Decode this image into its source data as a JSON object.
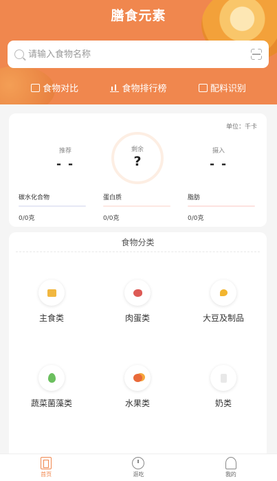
{
  "app": {
    "title": "膳食元素"
  },
  "search": {
    "placeholder": "请输入食物名称"
  },
  "quick_actions": [
    {
      "label": "食物对比",
      "icon": "compare-icon"
    },
    {
      "label": "食物排行榜",
      "icon": "ranking-icon"
    },
    {
      "label": "配料识别",
      "icon": "ingredient-scan-icon"
    }
  ],
  "summary": {
    "unit": "单位：千卡",
    "recommended": {
      "label": "推荐",
      "value": "- -"
    },
    "remaining": {
      "label": "剩余",
      "value": "?"
    },
    "intake": {
      "label": "摄入",
      "value": "- -"
    },
    "macros": [
      {
        "name": "碳水化合物",
        "amount": "0/0克",
        "color": "#e6e8f5"
      },
      {
        "name": "蛋白质",
        "amount": "0/0克",
        "color": "#fde7e2"
      },
      {
        "name": "脂肪",
        "amount": "0/0克",
        "color": "#fde2df"
      }
    ]
  },
  "categories": {
    "title": "食物分类",
    "items": [
      {
        "name": "主食类",
        "icon": "staple-food-icon"
      },
      {
        "name": "肉蛋类",
        "icon": "meat-egg-icon"
      },
      {
        "name": "大豆及制品",
        "icon": "soybean-icon"
      },
      {
        "name": "蔬菜菌藻类",
        "icon": "vegetable-icon"
      },
      {
        "name": "水果类",
        "icon": "fruit-icon"
      },
      {
        "name": "奶类",
        "icon": "milk-icon"
      }
    ]
  },
  "tabbar": [
    {
      "label": "首页",
      "active": true
    },
    {
      "label": "逛吃",
      "active": false
    },
    {
      "label": "我的",
      "active": false
    }
  ],
  "colors": {
    "brand": "#f0874e"
  }
}
